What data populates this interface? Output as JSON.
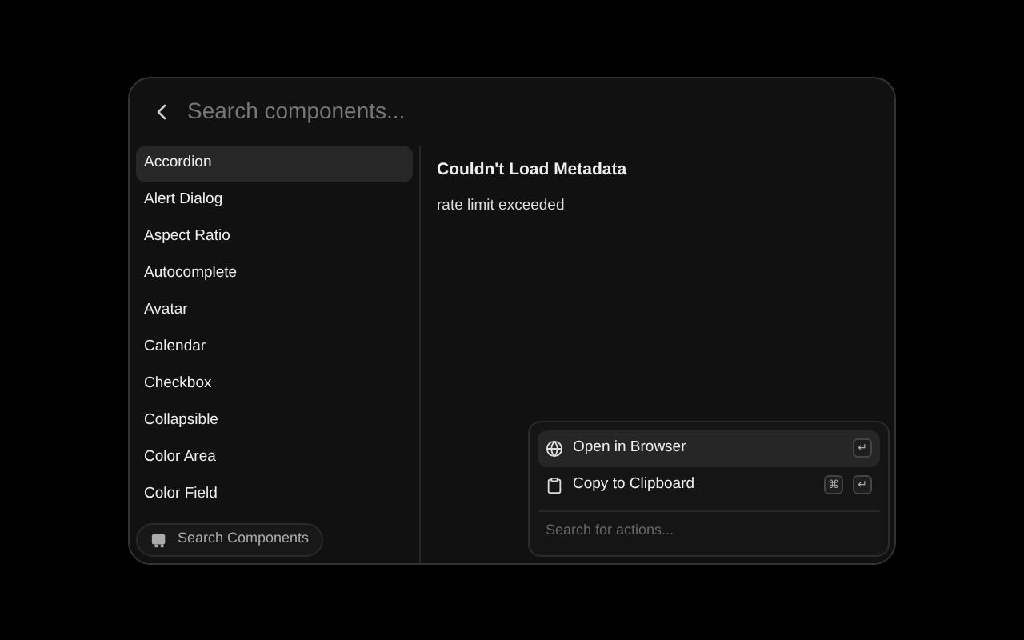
{
  "search": {
    "placeholder": "Search components..."
  },
  "sidebar": {
    "items": [
      {
        "label": "Accordion",
        "selected": true
      },
      {
        "label": "Alert Dialog",
        "selected": false
      },
      {
        "label": "Aspect Ratio",
        "selected": false
      },
      {
        "label": "Autocomplete",
        "selected": false
      },
      {
        "label": "Avatar",
        "selected": false
      },
      {
        "label": "Calendar",
        "selected": false
      },
      {
        "label": "Checkbox",
        "selected": false
      },
      {
        "label": "Collapsible",
        "selected": false
      },
      {
        "label": "Color Area",
        "selected": false
      },
      {
        "label": "Color Field",
        "selected": false
      }
    ]
  },
  "detail": {
    "title": "Couldn't Load Metadata",
    "message": "rate limit exceeded"
  },
  "footer_button": {
    "label": "Search Components"
  },
  "actions": {
    "items": [
      {
        "kind": "globe",
        "label": "Open in Browser",
        "keys": [
          "↵"
        ],
        "selected": true
      },
      {
        "kind": "clipboard",
        "label": "Copy to Clipboard",
        "keys": [
          "⌘",
          "↵"
        ],
        "selected": false
      }
    ],
    "search": {
      "placeholder": "Search for actions..."
    }
  }
}
